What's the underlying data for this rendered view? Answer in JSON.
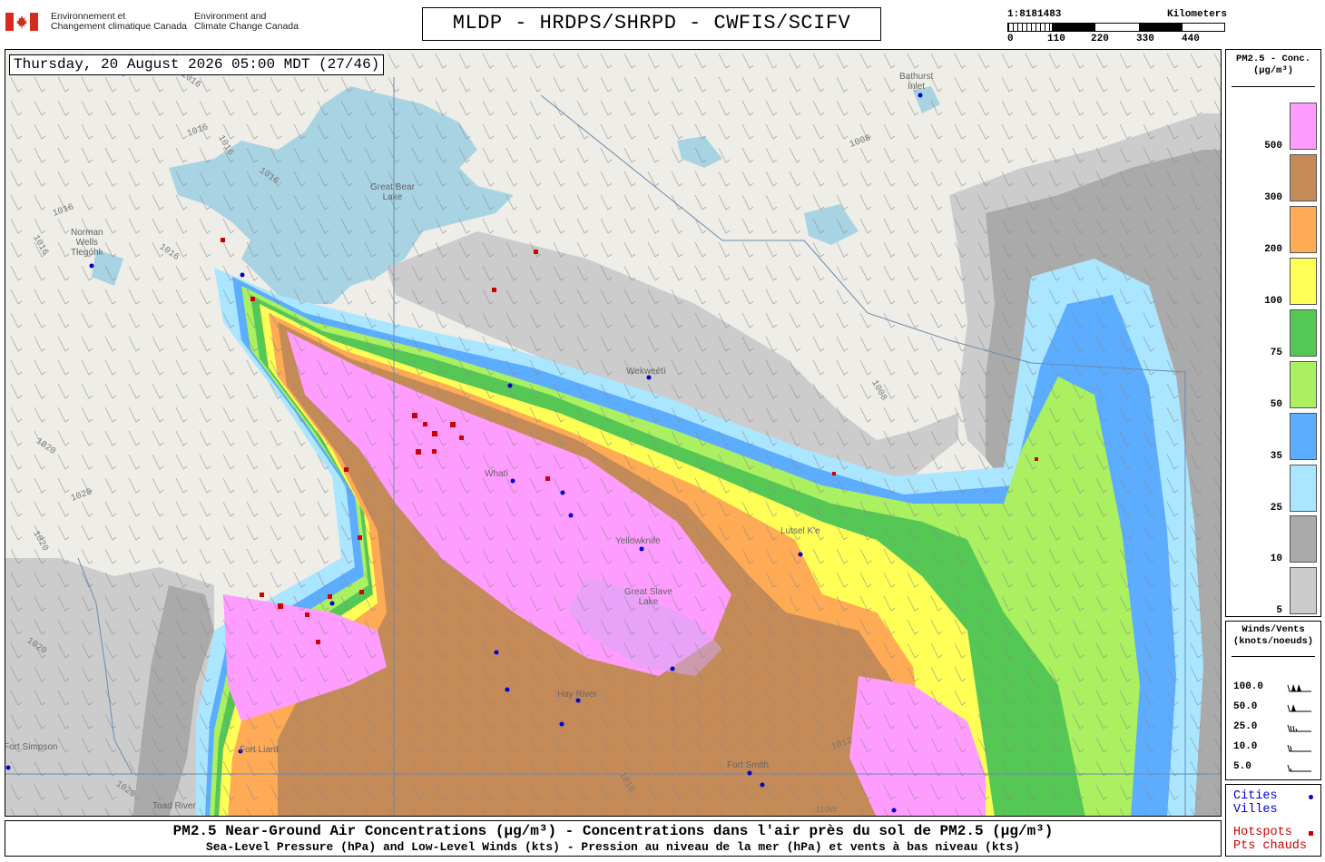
{
  "header": {
    "gov_fr": "Environnement et\nChangement climatique Canada",
    "gov_en": "Environment and\nClimate Change Canada",
    "title": "MLDP - HRDPS/SHRPD - CWFIS/SCIFV",
    "scale_ratio": "1:8181483",
    "scale_unit": "Kilometers",
    "scale_ticks": [
      "0",
      "110",
      "220",
      "330",
      "440"
    ]
  },
  "map": {
    "timestamp": "Thursday, 20 August 2026 05:00 MDT (27/46)",
    "colors": {
      "land": "#eeede7",
      "water": "#a8d3e3",
      "border": "#6b8bb0"
    },
    "places": [
      {
        "name": "Bathurst\nInlet"
      },
      {
        "name": "Great Bear\nLake"
      },
      {
        "name": "Norman\nWells\nTłegóhłı"
      },
      {
        "name": "Wekweètì"
      },
      {
        "name": "Whatì"
      },
      {
        "name": "Yellowknife"
      },
      {
        "name": "Great Slave\nLake"
      },
      {
        "name": "Lutsel K'e"
      },
      {
        "name": "Hay River"
      },
      {
        "name": "Fort Smith"
      },
      {
        "name": "Fort Liard"
      },
      {
        "name": "Toad River"
      },
      {
        "name": "Fort Simpson"
      }
    ],
    "isobars": [
      "1016",
      "1016",
      "1016",
      "1016",
      "1016",
      "1016",
      "1016",
      "1008",
      "1008",
      "1020",
      "1020",
      "1020",
      "1020",
      "1012",
      "1016",
      "1020"
    ],
    "graticule_labels": [
      "110W"
    ]
  },
  "legend": {
    "title": "PM2.5 - Conc.\n(µg/m³)",
    "levels": [
      {
        "label": "500",
        "color": "#ff9cff"
      },
      {
        "label": "300",
        "color": "#c48a58"
      },
      {
        "label": "200",
        "color": "#ffaa55"
      },
      {
        "label": "100",
        "color": "#ffff55"
      },
      {
        "label": "75",
        "color": "#55c755"
      },
      {
        "label": "50",
        "color": "#aaf060"
      },
      {
        "label": "35",
        "color": "#5cacff"
      },
      {
        "label": "25",
        "color": "#aae6ff"
      },
      {
        "label": "10",
        "color": "#aaaaaa"
      },
      {
        "label": "5",
        "color": "#cccccc"
      }
    ],
    "wind_title": "Winds/Vents\n(knots/noeuds)",
    "wind_levels": [
      {
        "label": "100.0",
        "kts": 100
      },
      {
        "label": "50.0",
        "kts": 50
      },
      {
        "label": "25.0",
        "kts": 25
      },
      {
        "label": "10.0",
        "kts": 10
      },
      {
        "label": "5.0",
        "kts": 5
      }
    ],
    "cities_label_en": "Cities",
    "cities_label_fr": "Villes",
    "hotspots_label_en": "Hotspots",
    "hotspots_label_fr": "Pts chauds",
    "cities_color": "#0000cc",
    "hotspots_color": "#cc0000"
  },
  "footer": {
    "line1": "PM2.5 Near-Ground Air Concentrations (µg/m³) - Concentrations dans l'air près du sol de PM2.5 (µg/m³)",
    "line2": "Sea-Level Pressure (hPa) and Low-Level Winds (kts) - Pression au niveau de la mer (hPa) et vents à bas niveau (kts)"
  }
}
